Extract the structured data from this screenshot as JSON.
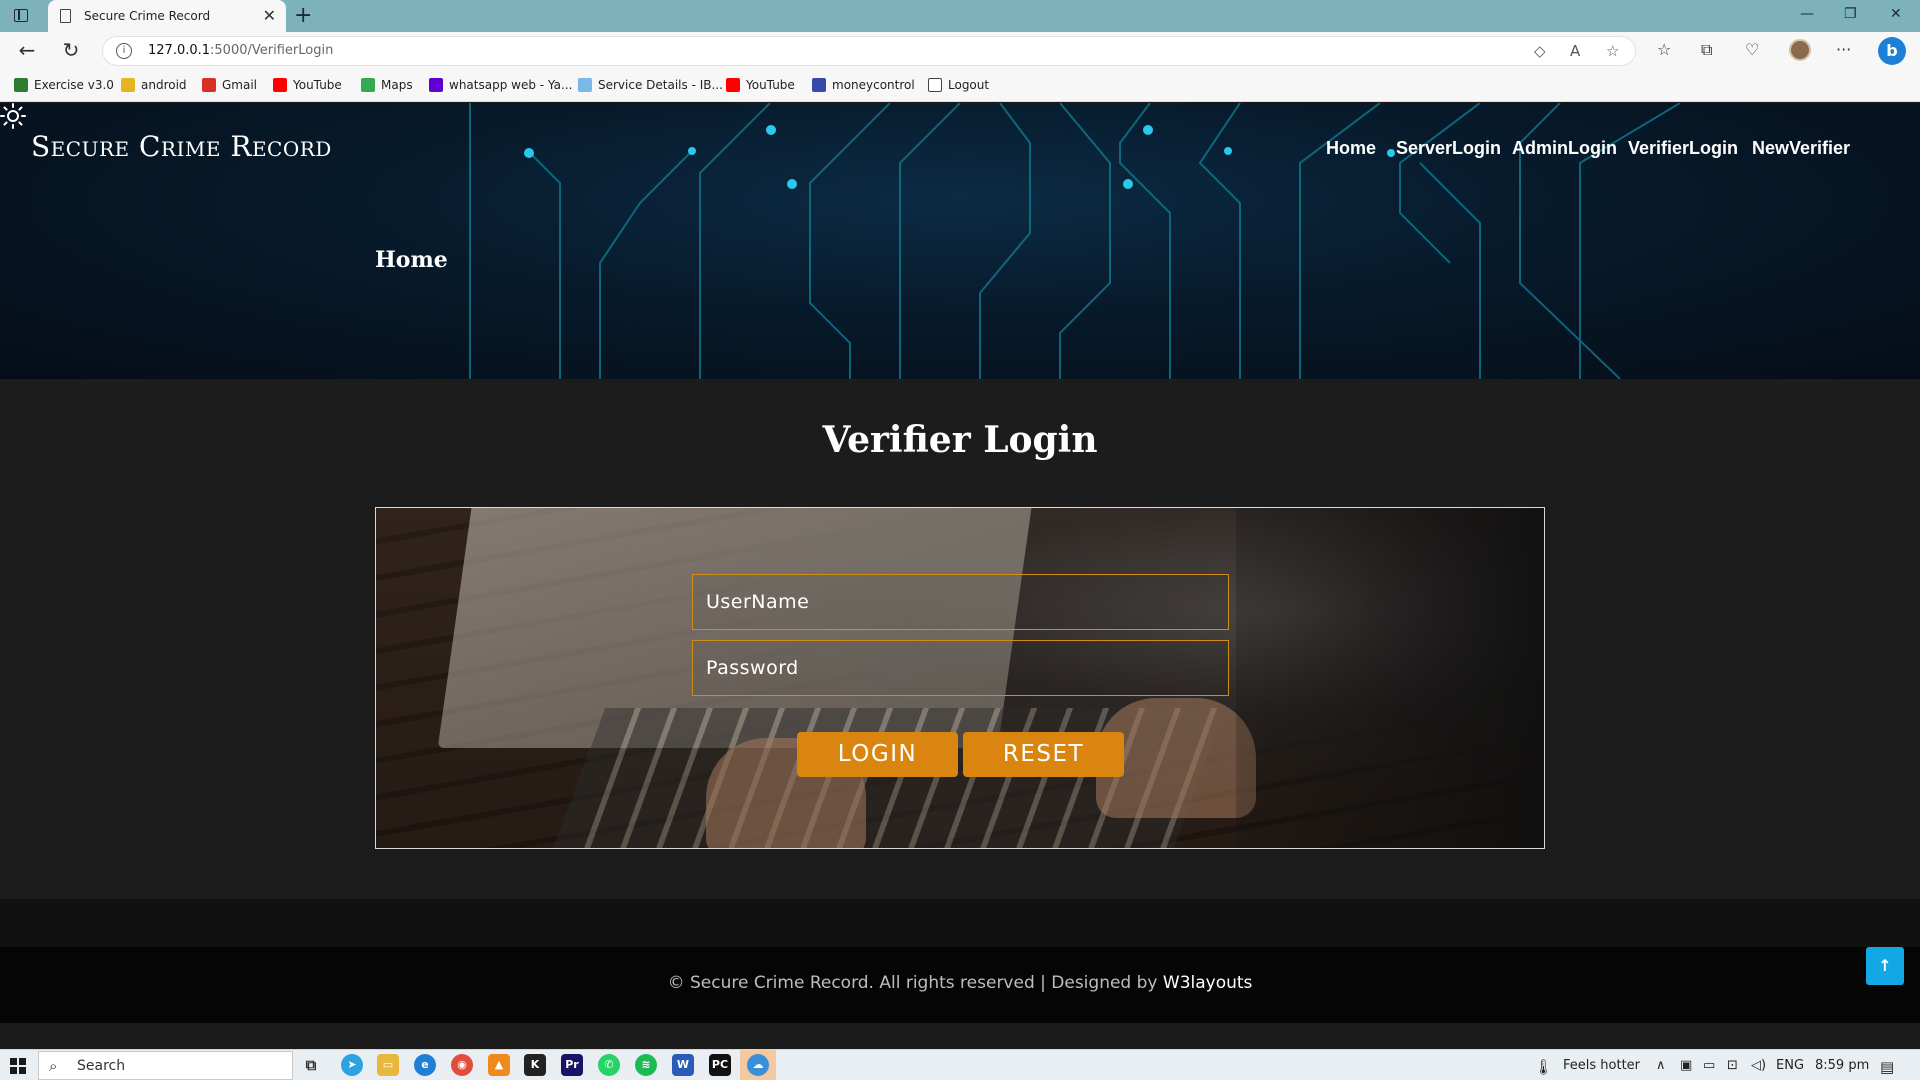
{
  "browser": {
    "tab_title": "Secure Crime Record",
    "url_host": "127.0.0.1",
    "url_path": ":5000/VerifierLogin",
    "bookmarks": [
      {
        "label": "Exercise v3.0",
        "icon": "w-icon",
        "color": "#2e7d32"
      },
      {
        "label": "android",
        "icon": "folder-icon",
        "color": "#e6b422"
      },
      {
        "label": "Gmail",
        "icon": "gmail-icon",
        "color": "#d93025"
      },
      {
        "label": "YouTube",
        "icon": "youtube-icon",
        "color": "#ff0000"
      },
      {
        "label": "Maps",
        "icon": "maps-pin-icon",
        "color": "#34a853"
      },
      {
        "label": "whatsapp web - Ya...",
        "icon": "yahoo-icon",
        "color": "#5f01d1"
      },
      {
        "label": "Service Details - IB...",
        "icon": "cloud-icon",
        "color": "#7ab8e6"
      },
      {
        "label": "YouTube",
        "icon": "youtube-icon",
        "color": "#ff0000"
      },
      {
        "label": "moneycontrol",
        "icon": "moneycontrol-icon",
        "color": "#3949ab"
      },
      {
        "label": "Logout",
        "icon": "page-icon",
        "color": "#ffffff"
      }
    ]
  },
  "site": {
    "brand": "Secure Crime Record",
    "nav": [
      "Home",
      "ServerLogin",
      "AdminLogin",
      "VerifierLogin",
      "NewVerifier"
    ],
    "breadcrumb": "Home"
  },
  "form": {
    "title": "Verifier Login",
    "username_placeholder": "UserName",
    "password_placeholder": "Password",
    "login_label": "LOGIN",
    "reset_label": "RESET",
    "accent_color": "#d9850f"
  },
  "footer": {
    "copyright": "© Secure Crime Record. All rights reserved | Designed by ",
    "designer": "W3layouts"
  },
  "taskbar": {
    "search_label": "Search",
    "weather": "Feels hotter",
    "language": "ENG",
    "time": "8:59 pm"
  }
}
